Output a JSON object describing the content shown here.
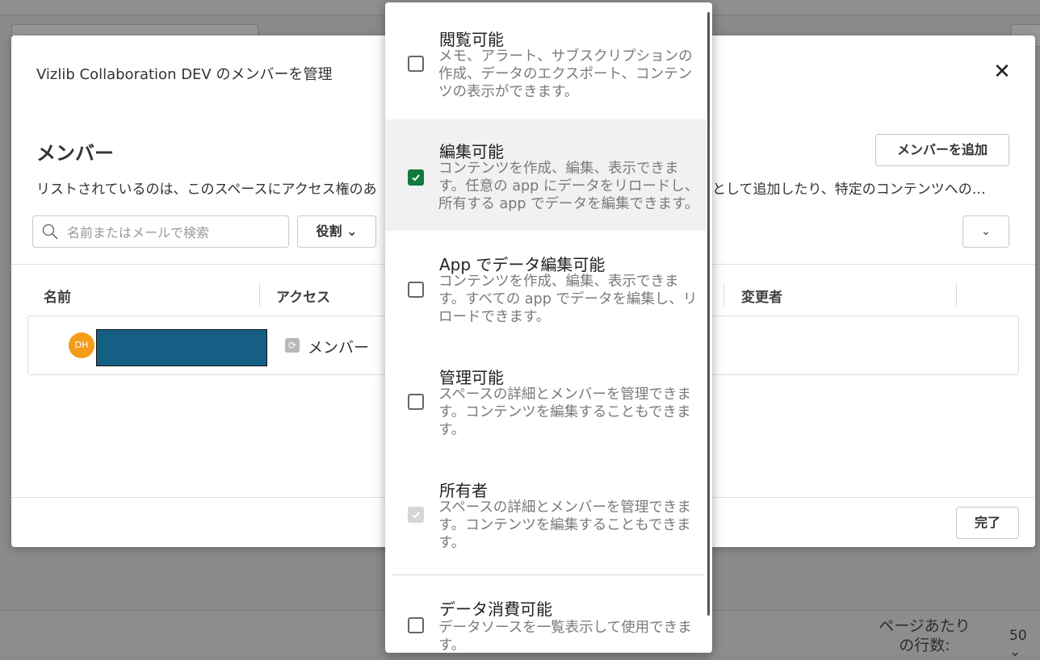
{
  "background": {
    "rows_per_page_label": "ページあたり\nの行数:",
    "rows_per_page_value": "50 ⌄"
  },
  "modal": {
    "title": "Vizlib Collaboration DEV のメンバーを管理",
    "close_glyph": "✕",
    "heading": "メンバー",
    "add_member_label": "メンバーを追加",
    "description_left": "リストされているのは、このスペースにアクセス権のあ",
    "description_right": "として追加したり、特定のコンテンツへの…",
    "search_placeholder": "名前またはメールで検索",
    "role_filter_label": "役割 ⌄",
    "right_dropdown_glyph": "⌄",
    "columns": {
      "name": "名前",
      "access": "アクセス",
      "modified_by": "変更者"
    },
    "rows": [
      {
        "avatar_initials": "DH",
        "avatar_color": "#f59c1a",
        "access": "メンバー"
      }
    ],
    "done_label": "完了"
  },
  "role_options": [
    {
      "title": "閲覧可能",
      "description": "メモ、アラート、サブスクリプションの作成、データのエクスポート、コンテンツの表示ができます。",
      "state": "unchecked"
    },
    {
      "title": "編集可能",
      "description": "コンテンツを作成、編集、表示できます。任意の app にデータをリロードし、所有する app でデータを編集できます。",
      "state": "checked"
    },
    {
      "title": "App でデータ編集可能",
      "description": "コンテンツを作成、編集、表示できます。すべての app でデータを編集し、リロードできます。",
      "state": "unchecked"
    },
    {
      "title": "管理可能",
      "description": "スペースの詳細とメンバーを管理できます。コンテンツを編集することもできます。",
      "state": "unchecked"
    },
    {
      "title": "所有者",
      "description": "スペースの詳細とメンバーを管理できます。コンテンツを編集することもできます。",
      "state": "disabled-checked"
    },
    {
      "title": "データ消費可能",
      "description": "データソースを一覧表示して使用できます。",
      "state": "unchecked"
    }
  ],
  "colors": {
    "accent_green": "#0f7b3c",
    "redaction": "#155f85"
  }
}
